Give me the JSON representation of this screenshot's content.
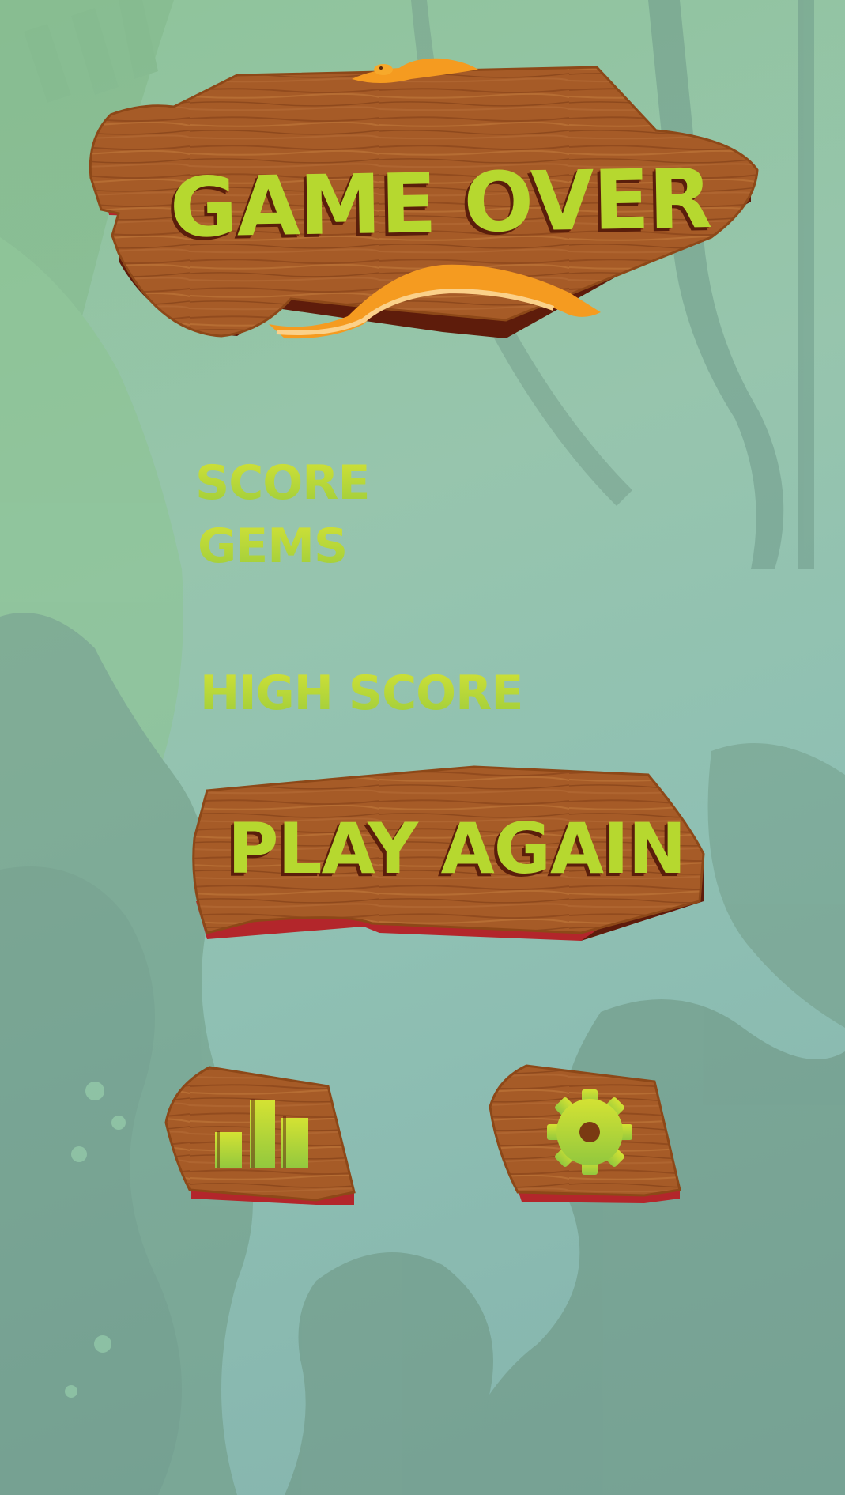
{
  "title": "GAME OVER",
  "stats": {
    "score_label": "SCORE",
    "gems_label": "GEMS",
    "high_score_label": "HIGH SCORE"
  },
  "buttons": {
    "play_again": "PLAY AGAIN",
    "leaderboard_icon": "bar-chart-icon",
    "settings_icon": "gear-icon"
  },
  "colors": {
    "text_green": "#b6d82f",
    "wood": "#a45a26",
    "wood_edge": "#b3262b",
    "snake": "#f59b20"
  }
}
